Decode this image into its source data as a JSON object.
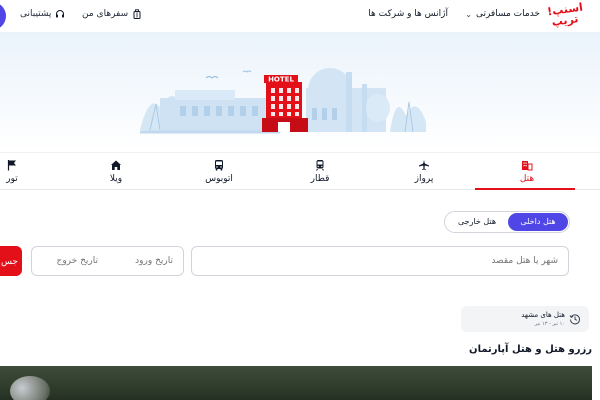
{
  "header": {
    "logo_line1": "اسنپ!",
    "logo_line2": "تریپ",
    "nav_services": "خدمات مسافرتی",
    "nav_agency": "آژانس ها و شرکت ها",
    "my_trips": "سفرهای من",
    "support": "پشتیبانی"
  },
  "tabs": [
    {
      "label": "هتل",
      "icon": "hotel-icon",
      "active": true
    },
    {
      "label": "پرواز",
      "icon": "plane-icon"
    },
    {
      "label": "قطار",
      "icon": "train-icon"
    },
    {
      "label": "اتوبوس",
      "icon": "bus-icon"
    },
    {
      "label": "ویلا",
      "icon": "house-icon"
    },
    {
      "label": "تور",
      "icon": "flag-icon"
    }
  ],
  "hero": {
    "hotel_sign": "HOTEL"
  },
  "segment": {
    "domestic": "هتل داخلی",
    "foreign": "هتل خارجی"
  },
  "search": {
    "city_placeholder": "شهر یا هتل مقصد",
    "checkin_placeholder": "تاریخ ورود",
    "checkout_placeholder": "تاریخ خروج",
    "button_label": "جس"
  },
  "recent": {
    "title": "هتل های مشهد",
    "subtitle": "۱۰ تیر - ۱۳ تیر"
  },
  "section_title": "رزرو هتل و هتل آپارتمان",
  "colors": {
    "brand_red": "#e3101a",
    "accent_blue": "#4f46e5"
  }
}
